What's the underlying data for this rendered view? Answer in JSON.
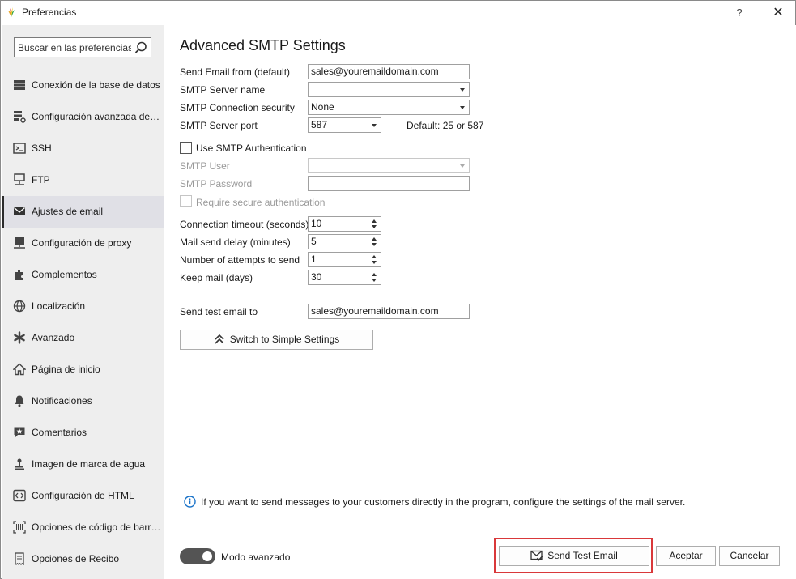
{
  "window": {
    "title": "Preferencias",
    "help_label": "?",
    "close_label": "✕"
  },
  "sidebar": {
    "search_placeholder": "Buscar en las preferencias",
    "items": [
      {
        "label": "Conexión de la base de datos",
        "icon": "database-icon"
      },
      {
        "label": "Configuración avanzada de la ...",
        "icon": "database-settings-icon"
      },
      {
        "label": "SSH",
        "icon": "terminal-icon"
      },
      {
        "label": "FTP",
        "icon": "ftp-network-icon"
      },
      {
        "label": "Ajustes de email",
        "icon": "envelope-icon",
        "active": true
      },
      {
        "label": "Configuración de proxy",
        "icon": "proxy-server-icon"
      },
      {
        "label": "Complementos",
        "icon": "puzzle-icon"
      },
      {
        "label": "Localización",
        "icon": "globe-icon"
      },
      {
        "label": "Avanzado",
        "icon": "asterisk-icon"
      },
      {
        "label": "Página de inicio",
        "icon": "home-icon"
      },
      {
        "label": "Notificaciones",
        "icon": "bell-icon"
      },
      {
        "label": "Comentarios",
        "icon": "comment-star-icon"
      },
      {
        "label": "Imagen de marca de agua",
        "icon": "stamp-icon"
      },
      {
        "label": "Configuración de HTML",
        "icon": "code-icon"
      },
      {
        "label": "Opciones de código de barras",
        "icon": "barcode-icon"
      },
      {
        "label": "Opciones de Recibo",
        "icon": "receipt-icon"
      }
    ]
  },
  "main": {
    "title": "Advanced SMTP Settings",
    "send_from": {
      "label": "Send Email from (default)",
      "value": "sales@youremaildomain.com"
    },
    "server_name": {
      "label": "SMTP Server name",
      "value": ""
    },
    "security": {
      "label": "SMTP Connection security",
      "value": "None"
    },
    "port": {
      "label": "SMTP Server port",
      "value": "587",
      "hint": "Default: 25 or 587"
    },
    "use_auth": {
      "label": "Use SMTP Authentication",
      "checked": false
    },
    "smtp_user": {
      "label": "SMTP User",
      "value": ""
    },
    "smtp_password": {
      "label": "SMTP Password",
      "value": ""
    },
    "secure_auth": {
      "label": "Require secure authentication",
      "checked": false
    },
    "timeout": {
      "label": "Connection timeout (seconds)",
      "value": "10"
    },
    "send_delay": {
      "label": "Mail send delay (minutes)",
      "value": "5"
    },
    "attempts": {
      "label": "Number of attempts to send",
      "value": "1"
    },
    "keep_mail": {
      "label": "Keep mail (days)",
      "value": "30"
    },
    "test_email": {
      "label": "Send test email to",
      "value": "sales@youremaildomain.com"
    },
    "switch_button": "Switch to Simple Settings",
    "info_text": "If you want to send messages to your customers directly in the program, configure the settings of the mail server."
  },
  "footer": {
    "toggle_label": "Modo avanzado",
    "toggle_on": true,
    "send_test_button": "Send Test Email",
    "ok_button": "Aceptar",
    "cancel_button": "Cancelar"
  },
  "colors": {
    "sidebar_bg": "#eeeeee",
    "active_item_bg": "#e0e0e6",
    "highlight": "#d9383a",
    "info_blue": "#1a73c9",
    "toggle_bg": "#545454"
  }
}
